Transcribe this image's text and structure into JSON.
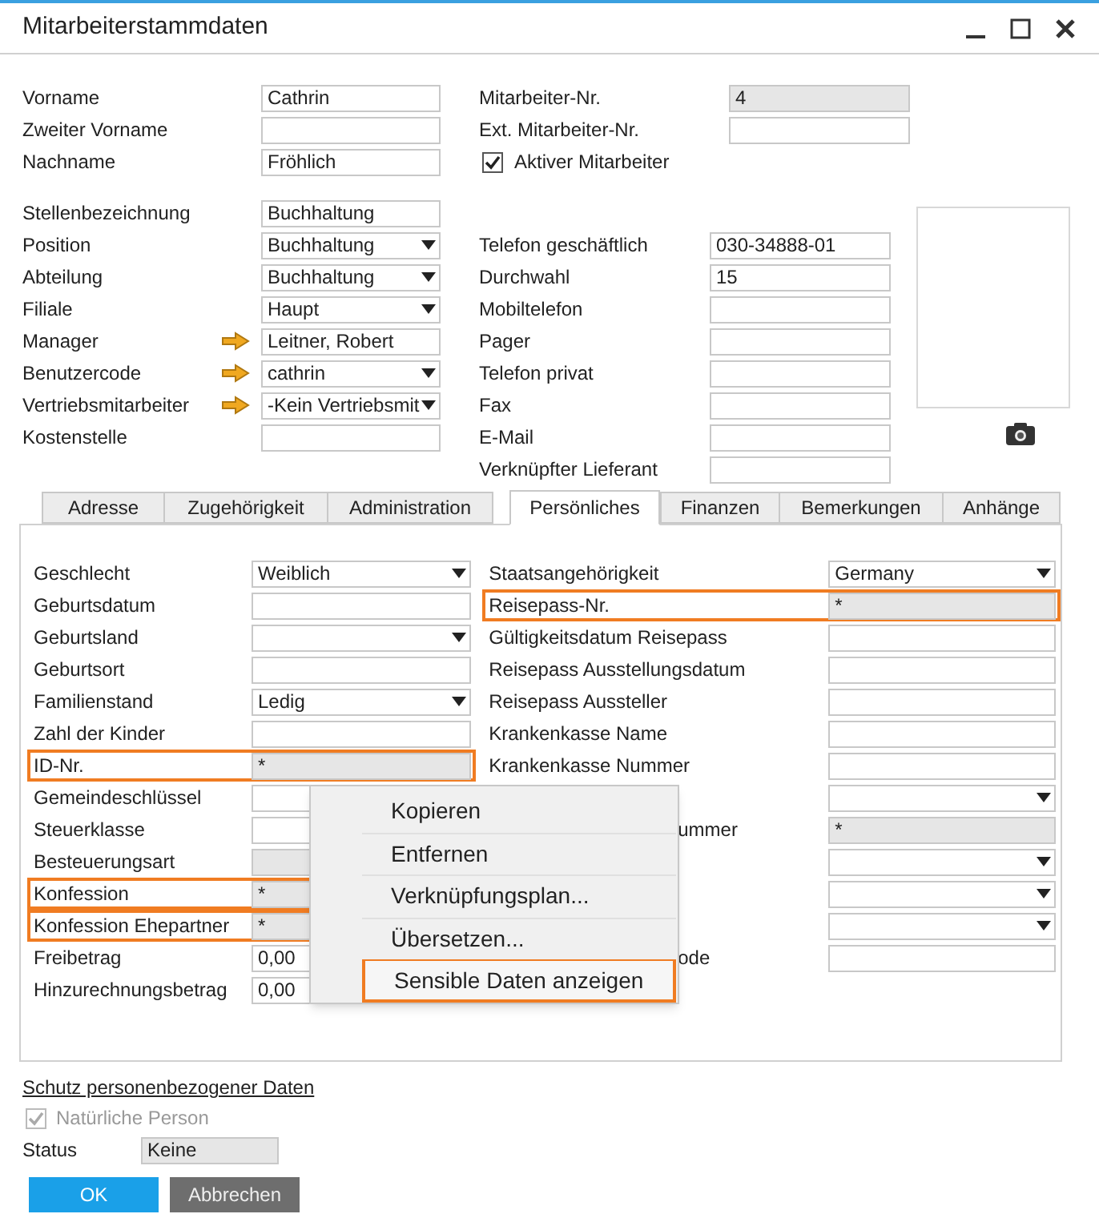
{
  "window": {
    "title": "Mitarbeiterstammdaten"
  },
  "header": {
    "left_top": [
      {
        "label": "Vorname",
        "kind": "text",
        "value": "Cathrin"
      },
      {
        "label": "Zweiter Vorname",
        "kind": "text"
      },
      {
        "label": "Nachname",
        "kind": "text",
        "value": "Fröhlich"
      }
    ],
    "right_top": [
      {
        "label": "Mitarbeiter-Nr.",
        "kind": "readonly",
        "value": "4"
      },
      {
        "label": "Ext. Mitarbeiter-Nr.",
        "kind": "text"
      },
      {
        "label": "Aktiver Mitarbeiter",
        "kind": "checkbox",
        "checked": true
      }
    ],
    "left": [
      {
        "label": "Stellenbezeichnung",
        "kind": "text",
        "value": "Buchhaltung",
        "linked": false
      },
      {
        "label": "Position",
        "kind": "dropdown",
        "value": "Buchhaltung",
        "linked": false
      },
      {
        "label": "Abteilung",
        "kind": "dropdown",
        "value": "Buchhaltung",
        "linked": false
      },
      {
        "label": "Filiale",
        "kind": "dropdown",
        "value": "Haupt",
        "linked": false
      },
      {
        "label": "Manager",
        "kind": "text",
        "value": "Leitner, Robert",
        "linked": true
      },
      {
        "label": "Benutzercode",
        "kind": "dropdown",
        "value": "cathrin",
        "linked": true
      },
      {
        "label": "Vertriebsmitarbeiter",
        "kind": "dropdown",
        "value": "-Kein Vertriebsmit",
        "linked": true
      },
      {
        "label": "Kostenstelle",
        "kind": "text",
        "linked": false
      }
    ],
    "right": [
      {
        "label": "Telefon geschäftlich",
        "kind": "text",
        "value": "030-34888-01"
      },
      {
        "label": "Durchwahl",
        "kind": "text",
        "value": "15"
      },
      {
        "label": "Mobiltelefon",
        "kind": "text"
      },
      {
        "label": "Pager",
        "kind": "text"
      },
      {
        "label": "Telefon privat",
        "kind": "text"
      },
      {
        "label": "Fax",
        "kind": "text"
      },
      {
        "label": "E-Mail",
        "kind": "text"
      },
      {
        "label": "Verknüpfter Lieferant",
        "kind": "text"
      }
    ]
  },
  "tabs": [
    {
      "label": "Adresse",
      "selected": false
    },
    {
      "label": "Zugehörigkeit",
      "selected": false
    },
    {
      "label": "Administration",
      "selected": false
    },
    {
      "label": "Persönliches",
      "selected": true
    },
    {
      "label": "Finanzen",
      "selected": false
    },
    {
      "label": "Bemerkungen",
      "selected": false
    },
    {
      "label": "Anhänge",
      "selected": false
    }
  ],
  "personal": {
    "left": [
      {
        "label": "Geschlecht",
        "kind": "dropdown",
        "value": "Weiblich",
        "highlighted": false
      },
      {
        "label": "Geburtsdatum",
        "kind": "text",
        "highlighted": false
      },
      {
        "label": "Geburtsland",
        "kind": "dropdown",
        "highlighted": false
      },
      {
        "label": "Geburtsort",
        "kind": "text",
        "highlighted": false
      },
      {
        "label": "Familienstand",
        "kind": "dropdown",
        "value": "Ledig",
        "highlighted": false
      },
      {
        "label": "Zahl der Kinder",
        "kind": "text",
        "highlighted": false
      },
      {
        "label": "ID-Nr.",
        "kind": "readonly",
        "value": "*",
        "highlighted": true
      },
      {
        "label": "Gemeindeschlüssel",
        "kind": "text",
        "highlighted": false
      },
      {
        "label": "Steuerklasse",
        "kind": "text",
        "highlighted": false
      },
      {
        "label": "Besteuerungsart",
        "kind": "readonly",
        "highlighted": false
      },
      {
        "label": "Konfession",
        "kind": "readonly",
        "value": "*",
        "highlighted": true
      },
      {
        "label": "Konfession Ehepartner",
        "kind": "readonly",
        "value": "*",
        "highlighted": true
      },
      {
        "label": "Freibetrag",
        "kind": "text",
        "value": "0,00",
        "highlighted": false
      },
      {
        "label": "Hinzurechnungsbetrag",
        "kind": "text",
        "value": "0,00",
        "highlighted": false
      }
    ],
    "right": [
      {
        "label": "Staatsangehörigkeit",
        "kind": "dropdown",
        "value": "Germany",
        "highlighted": false,
        "label_clipped": false
      },
      {
        "label": "Reisepass-Nr.",
        "kind": "readonly",
        "value": "*",
        "highlighted": true,
        "label_clipped": false
      },
      {
        "label": "Gültigkeitsdatum Reisepass",
        "kind": "text",
        "highlighted": false,
        "label_clipped": false
      },
      {
        "label": "Reisepass Ausstellungsdatum",
        "kind": "text",
        "highlighted": false,
        "label_clipped": false
      },
      {
        "label": "Reisepass Aussteller",
        "kind": "text",
        "highlighted": false,
        "label_clipped": false
      },
      {
        "label": "Krankenkasse Name",
        "kind": "text",
        "highlighted": false,
        "label_clipped": false
      },
      {
        "label": "Krankenkasse Nummer",
        "kind": "text",
        "highlighted": false,
        "label_clipped": false
      },
      {
        "kind": "dropdown",
        "highlighted": false
      },
      {
        "label": "ummer",
        "kind": "readonly",
        "value": "*",
        "highlighted": false,
        "label_clipped": true
      },
      {
        "kind": "dropdown",
        "highlighted": false
      },
      {
        "kind": "dropdown",
        "highlighted": false
      },
      {
        "kind": "dropdown",
        "highlighted": false
      },
      {
        "label": "ode",
        "kind": "text",
        "highlighted": false,
        "label_clipped": true
      }
    ]
  },
  "context_menu": [
    {
      "label": "Kopieren",
      "highlighted": false
    },
    {
      "label": "Entfernen",
      "highlighted": false
    },
    {
      "label": "Verknüpfungsplan...",
      "highlighted": false
    },
    {
      "label": "Übersetzen...",
      "highlighted": false
    },
    {
      "label": "Sensible Daten anzeigen",
      "highlighted": true
    }
  ],
  "privacy": {
    "heading": "Schutz personenbezogener Daten",
    "checkbox": {
      "label": "Natürliche Person",
      "checked": true,
      "disabled": true
    },
    "status": {
      "label": "Status",
      "value": "Keine"
    }
  },
  "buttons": [
    {
      "label": "OK",
      "kind": "primary"
    },
    {
      "label": "Abbrechen",
      "kind": "secondary"
    }
  ]
}
